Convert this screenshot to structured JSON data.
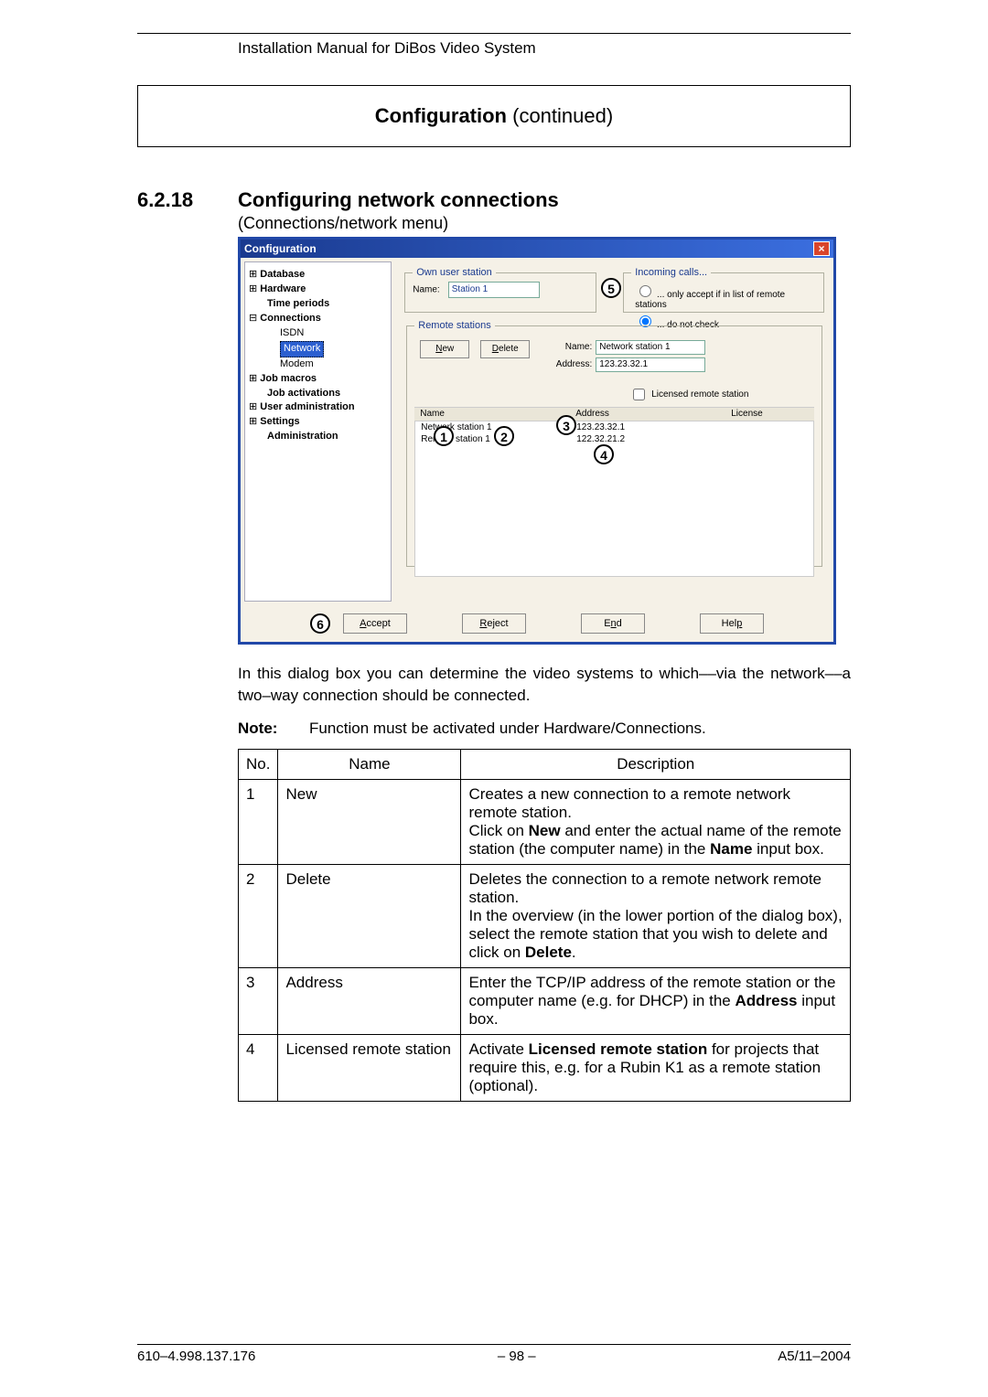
{
  "doc_title": "Installation Manual for DiBos Video System",
  "config_heading_bold": "Configuration",
  "config_heading_rest": " (continued)",
  "section_num": "6.2.18",
  "section_title": "Configuring network connections",
  "section_sub": "(Connections/network menu)",
  "dialog": {
    "title": "Configuration",
    "close": "×",
    "tree": {
      "database": "Database",
      "hardware": "Hardware",
      "time_periods": "Time periods",
      "connections": "Connections",
      "isdn": "ISDN",
      "network": "Network",
      "modem": "Modem",
      "job_macros": "Job macros",
      "job_activations": "Job activations",
      "user_admin": "User administration",
      "settings": "Settings",
      "administration": "Administration"
    },
    "own": {
      "legend": "Own user station",
      "name_label": "Name:",
      "name_value": "Station 1"
    },
    "incoming": {
      "legend": "Incoming calls...",
      "opt1": "... only accept if in list of remote stations",
      "opt2": "... do not check"
    },
    "remote": {
      "legend": "Remote stations",
      "new": "New",
      "delete": "Delete",
      "name_label": "Name:",
      "name_value": "Network station 1",
      "addr_label": "Address:",
      "addr_value": "123.23.32.1",
      "licensed": "Licensed remote station",
      "col_name": "Name",
      "col_addr": "Address",
      "col_lic": "License",
      "rows": [
        {
          "n": "Network station 1",
          "a": "123.23.32.1"
        },
        {
          "n": "Remote station 1",
          "a": "122.32.21.2"
        }
      ]
    },
    "footer": {
      "accept": "Accept",
      "reject": "Reject",
      "end": "End",
      "help": "Help"
    },
    "callouts": {
      "c1": "1",
      "c2": "2",
      "c3": "3",
      "c4": "4",
      "c5": "5",
      "c6": "6"
    }
  },
  "body_text": "In this dialog box you can determine the video systems to which––via the network––a two–way connection should be connected.",
  "note_label": "Note:",
  "note_text": "Function must be activated under Hardware/Connections.",
  "table": {
    "h_no": "No.",
    "h_name": "Name",
    "h_desc": "Description",
    "rows": [
      {
        "no": "1",
        "name": "New",
        "desc_html": "Creates a new connection to a remote network remote station.<br>Click on <b>New</b> and enter the actual name of the remote station (the computer name) in the <b>Name</b> input box."
      },
      {
        "no": "2",
        "name": "Delete",
        "desc_html": "Deletes the connection to a remote network remote station.<br>In the overview (in the lower portion of the dialog box), select the remote station that you wish to delete and click on <b>Delete</b>."
      },
      {
        "no": "3",
        "name": "Address",
        "desc_html": "Enter the TCP/IP address of the remote station or the computer name (e.g. for DHCP) in the <b>Address</b> input box."
      },
      {
        "no": "4",
        "name": "Licensed remote station",
        "desc_html": "Activate <b>Licensed remote station</b> for projects that require this, e.g. for a Rubin K1 as a remote station (optional)."
      }
    ]
  },
  "footer": {
    "left": "610–4.998.137.176",
    "center": "– 98 –",
    "right": "A5/11–2004"
  }
}
